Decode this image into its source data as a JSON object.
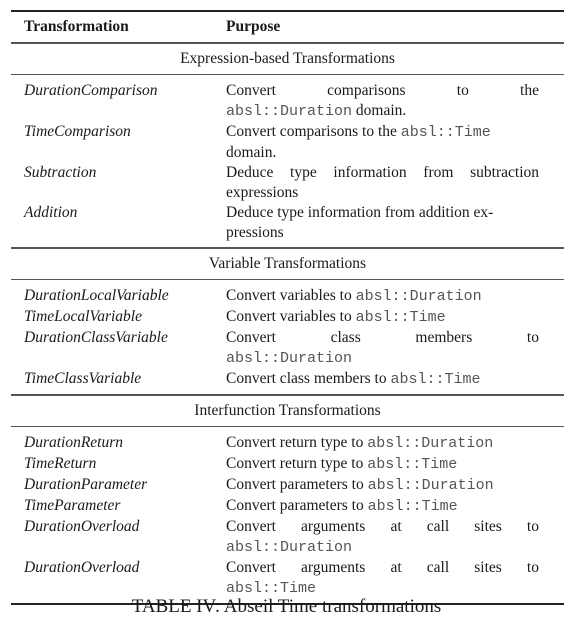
{
  "table": {
    "headers": {
      "transformation": "Transformation",
      "purpose": "Purpose"
    },
    "sections": [
      {
        "title": "Expression-based Transformations",
        "rows": [
          {
            "name": "DurationComparison",
            "purpose_text": "Convert comparisons to the",
            "purpose_code": "absl::Duration",
            "purpose_suffix": " domain.",
            "layout": "spread-break"
          },
          {
            "name": "TimeComparison",
            "purpose_text": "Convert comparisons to the ",
            "purpose_code": "absl::Time",
            "purpose_suffix": "domain.",
            "layout": "inline-break"
          },
          {
            "name": "Subtraction",
            "purpose_text": "Deduce type information from subtraction expressions",
            "purpose_code": "",
            "purpose_suffix": "",
            "layout": "plain"
          },
          {
            "name": "Addition",
            "purpose_text": "Deduce type information from addition ex-pressions",
            "purpose_code": "",
            "purpose_suffix": "",
            "layout": "plain"
          }
        ]
      },
      {
        "title": "Variable Transformations",
        "rows": [
          {
            "name": "DurationLocalVariable",
            "purpose_text": "Convert variables to ",
            "purpose_code": "absl::Duration",
            "purpose_suffix": "",
            "layout": "inline"
          },
          {
            "name": "TimeLocalVariable",
            "purpose_text": "Convert variables to ",
            "purpose_code": "absl::Time",
            "purpose_suffix": "",
            "layout": "inline"
          },
          {
            "name": "DurationClassVariable",
            "purpose_text": "Convert class members to",
            "purpose_code": "absl::Duration",
            "purpose_suffix": "",
            "layout": "spread-break"
          },
          {
            "name": "TimeClassVariable",
            "purpose_text": "Convert class members to ",
            "purpose_code": "absl::Time",
            "purpose_suffix": "",
            "layout": "inline"
          }
        ]
      },
      {
        "title": "Interfunction Transformations",
        "rows": [
          {
            "name": "DurationReturn",
            "purpose_text": "Convert return type to ",
            "purpose_code": "absl::Duration",
            "purpose_suffix": "",
            "layout": "inline"
          },
          {
            "name": "TimeReturn",
            "purpose_text": "Convert return type to ",
            "purpose_code": "absl::Time",
            "purpose_suffix": "",
            "layout": "inline"
          },
          {
            "name": "DurationParameter",
            "purpose_text": "Convert parameters to ",
            "purpose_code": "absl::Duration",
            "purpose_suffix": "",
            "layout": "inline"
          },
          {
            "name": "TimeParameter",
            "purpose_text": "Convert parameters to ",
            "purpose_code": "absl::Time",
            "purpose_suffix": "",
            "layout": "inline"
          },
          {
            "name": "DurationOverload",
            "purpose_text": "Convert arguments at call sites to",
            "purpose_code": "absl::Duration",
            "purpose_suffix": "",
            "layout": "spread-break"
          },
          {
            "name": "DurationOverload",
            "purpose_text": "Convert arguments at call sites to",
            "purpose_code": "absl::Time",
            "purpose_suffix": "",
            "layout": "spread-break"
          }
        ]
      }
    ]
  },
  "caption": "TABLE IV: Abseil Time transformations"
}
